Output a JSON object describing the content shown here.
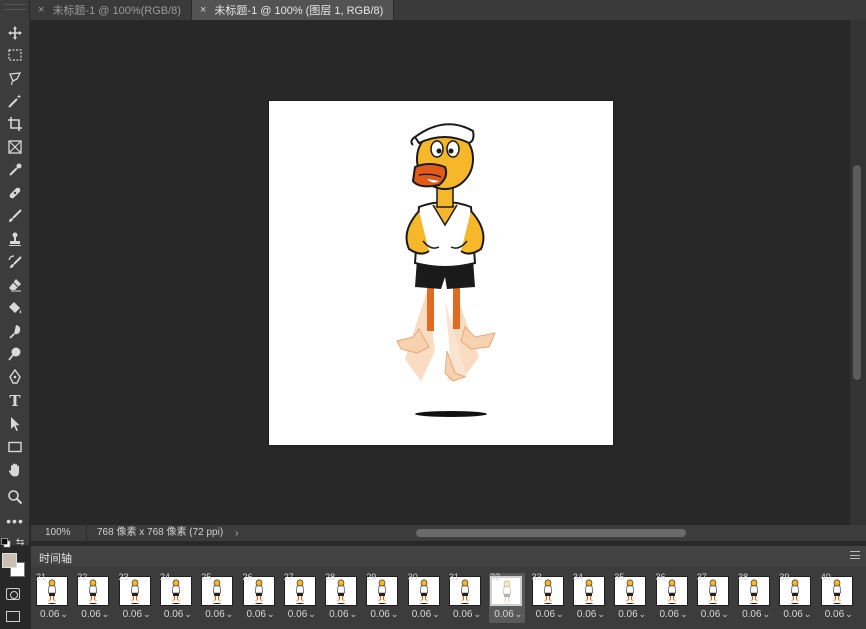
{
  "tabs": [
    {
      "label": "未标题-1 @ 100%(RGB/8)",
      "active": false
    },
    {
      "label": "未标题-1 @ 100% (图层 1, RGB/8)",
      "active": true
    }
  ],
  "status": {
    "zoom": "100%",
    "doc_info": "768 像素 x 768 像素 (72 ppi)",
    "arrow": "›"
  },
  "timeline": {
    "title": "时间轴",
    "frames": [
      {
        "number": "21",
        "delay": "0.06"
      },
      {
        "number": "22",
        "delay": "0.06"
      },
      {
        "number": "23",
        "delay": "0.06"
      },
      {
        "number": "24",
        "delay": "0.06"
      },
      {
        "number": "25",
        "delay": "0.06"
      },
      {
        "number": "26",
        "delay": "0.06"
      },
      {
        "number": "27",
        "delay": "0.06"
      },
      {
        "number": "28",
        "delay": "0.06"
      },
      {
        "number": "29",
        "delay": "0.06"
      },
      {
        "number": "30",
        "delay": "0.06"
      },
      {
        "number": "31",
        "delay": "0.06"
      },
      {
        "number": "32",
        "delay": "0.06"
      },
      {
        "number": "33",
        "delay": "0.06"
      },
      {
        "number": "34",
        "delay": "0.06"
      },
      {
        "number": "35",
        "delay": "0.06"
      },
      {
        "number": "36",
        "delay": "0.06"
      },
      {
        "number": "37",
        "delay": "0.06"
      },
      {
        "number": "38",
        "delay": "0.06"
      },
      {
        "number": "39",
        "delay": "0.06"
      },
      {
        "number": "40",
        "delay": "0.06"
      }
    ],
    "selected_frame": "32"
  },
  "colors": {
    "foreground": "#c9bfb3",
    "background": "#ffffff",
    "app_bg": "#282828",
    "panel_bg": "#3c3c3c"
  },
  "tools": [
    "move-icon",
    "marquee-icon",
    "lasso-icon",
    "magic-wand-icon",
    "crop-icon",
    "frame-icon",
    "eyedropper-icon",
    "healing-icon",
    "brush-icon",
    "stamp-icon",
    "history-brush-icon",
    "eraser-icon",
    "paint-bucket-icon",
    "blur-icon",
    "dodge-icon",
    "pen-icon",
    "type-icon",
    "path-select-icon",
    "rectangle-icon",
    "hand-icon",
    "zoom-icon",
    "more-tools-icon"
  ]
}
